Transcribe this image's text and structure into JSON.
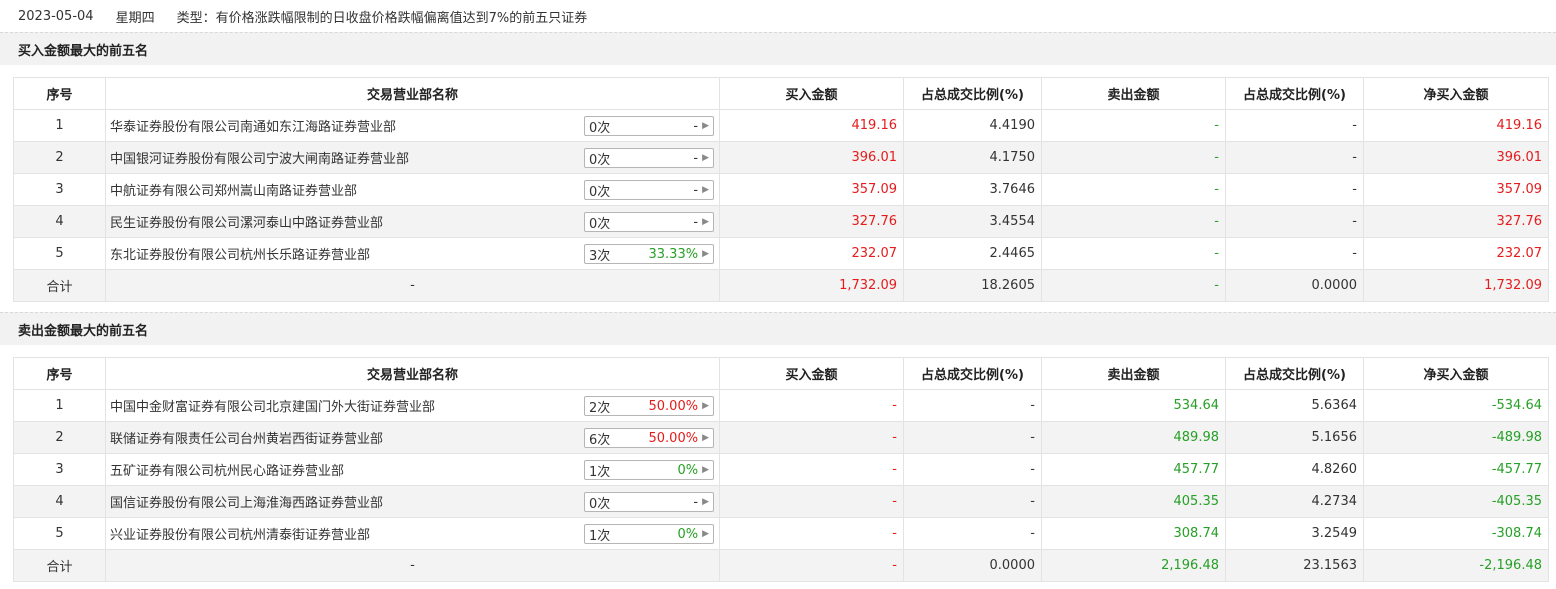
{
  "header": {
    "date": "2023-05-04",
    "weekday": "星期四",
    "type_text": "类型：有价格涨跌幅限制的日收盘价格跌幅偏离值达到7%的前五只证券"
  },
  "columns": [
    "序号",
    "交易营业部名称",
    "买入金额",
    "占总成交比例(%)",
    "卖出金额",
    "占总成交比例(%)",
    "净买入金额"
  ],
  "colors": {
    "up": "#e41c1c",
    "down": "#26a026"
  },
  "buy_section": {
    "title": "买入金额最大的前五名",
    "rows": [
      {
        "idx": "1",
        "name": "华泰证券股份有限公司南通如东江海路证券营业部",
        "count": "0次",
        "pct": "-",
        "pct_color": "none",
        "buy": "419.16",
        "buy_ratio": "4.4190",
        "sell": "-",
        "sell_ratio": "-",
        "net": "419.16"
      },
      {
        "idx": "2",
        "name": "中国银河证券股份有限公司宁波大闸南路证券营业部",
        "count": "0次",
        "pct": "-",
        "pct_color": "none",
        "buy": "396.01",
        "buy_ratio": "4.1750",
        "sell": "-",
        "sell_ratio": "-",
        "net": "396.01"
      },
      {
        "idx": "3",
        "name": "中航证券有限公司郑州嵩山南路证券营业部",
        "count": "0次",
        "pct": "-",
        "pct_color": "none",
        "buy": "357.09",
        "buy_ratio": "3.7646",
        "sell": "-",
        "sell_ratio": "-",
        "net": "357.09"
      },
      {
        "idx": "4",
        "name": "民生证券股份有限公司漯河泰山中路证券营业部",
        "count": "0次",
        "pct": "-",
        "pct_color": "none",
        "buy": "327.76",
        "buy_ratio": "3.4554",
        "sell": "-",
        "sell_ratio": "-",
        "net": "327.76"
      },
      {
        "idx": "5",
        "name": "东北证券股份有限公司杭州长乐路证券营业部",
        "count": "3次",
        "pct": "33.33%",
        "pct_color": "green",
        "buy": "232.07",
        "buy_ratio": "2.4465",
        "sell": "-",
        "sell_ratio": "-",
        "net": "232.07"
      }
    ],
    "total": {
      "label": "合计",
      "name": "-",
      "buy": "1,732.09",
      "buy_ratio": "18.2605",
      "sell": "-",
      "sell_ratio": "0.0000",
      "net": "1,732.09"
    }
  },
  "sell_section": {
    "title": "卖出金额最大的前五名",
    "rows": [
      {
        "idx": "1",
        "name": "中国中金财富证券有限公司北京建国门外大街证券营业部",
        "count": "2次",
        "pct": "50.00%",
        "pct_color": "red",
        "buy": "-",
        "buy_ratio": "-",
        "sell": "534.64",
        "sell_ratio": "5.6364",
        "net": "-534.64"
      },
      {
        "idx": "2",
        "name": "联储证券有限责任公司台州黄岩西街证券营业部",
        "count": "6次",
        "pct": "50.00%",
        "pct_color": "red",
        "buy": "-",
        "buy_ratio": "-",
        "sell": "489.98",
        "sell_ratio": "5.1656",
        "net": "-489.98"
      },
      {
        "idx": "3",
        "name": "五矿证券有限公司杭州民心路证券营业部",
        "count": "1次",
        "pct": "0%",
        "pct_color": "green",
        "buy": "-",
        "buy_ratio": "-",
        "sell": "457.77",
        "sell_ratio": "4.8260",
        "net": "-457.77"
      },
      {
        "idx": "4",
        "name": "国信证券股份有限公司上海淮海西路证券营业部",
        "count": "0次",
        "pct": "-",
        "pct_color": "none",
        "buy": "-",
        "buy_ratio": "-",
        "sell": "405.35",
        "sell_ratio": "4.2734",
        "net": "-405.35"
      },
      {
        "idx": "5",
        "name": "兴业证券股份有限公司杭州清泰街证券营业部",
        "count": "1次",
        "pct": "0%",
        "pct_color": "green",
        "buy": "-",
        "buy_ratio": "-",
        "sell": "308.74",
        "sell_ratio": "3.2549",
        "net": "-308.74"
      }
    ],
    "total": {
      "label": "合计",
      "name": "-",
      "buy": "-",
      "buy_ratio": "0.0000",
      "sell": "2,196.48",
      "sell_ratio": "23.1563",
      "net": "-2,196.48"
    }
  }
}
